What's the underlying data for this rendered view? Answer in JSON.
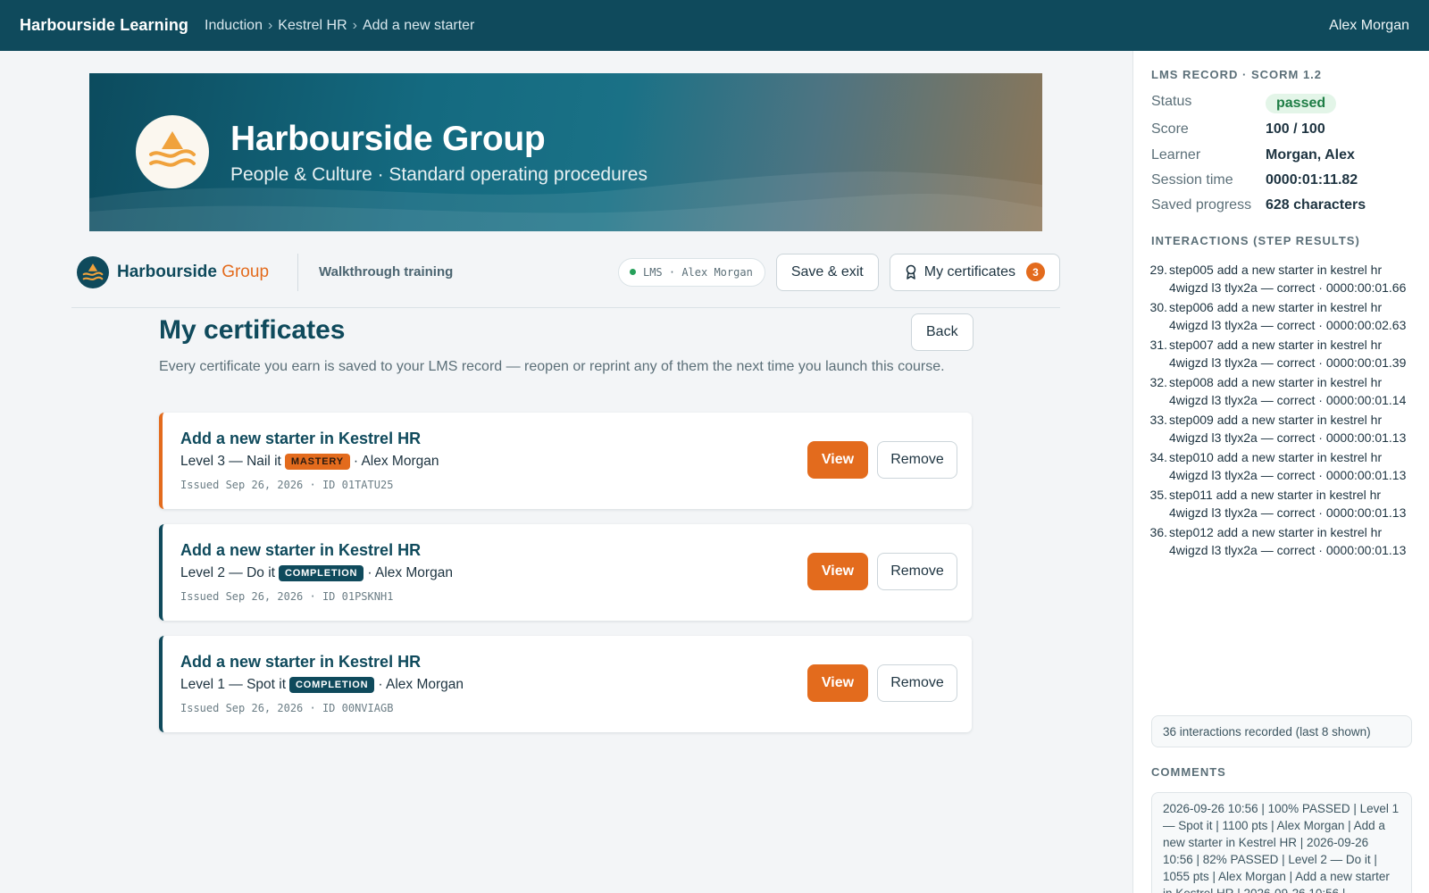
{
  "topbar": {
    "brand": "Harbourside Learning",
    "breadcrumbs": [
      "Induction",
      "Kestrel HR",
      "Add a new starter"
    ],
    "breadcrumb_separator": "›",
    "user": "Alex Morgan"
  },
  "hero": {
    "title": "Harbourside Group",
    "subtitle": "People & Culture · Standard operating procedures"
  },
  "subbar": {
    "org_name": "Harbourside",
    "org_accent": "Group",
    "training_label": "Walkthrough training",
    "lms_pill": "LMS · Alex Morgan",
    "save_exit_label": "Save & exit",
    "certificates_label": "My certificates",
    "certificates_count": "3"
  },
  "page": {
    "title": "My certificates",
    "back_label": "Back",
    "intro": "Every certificate you earn is saved to your LMS record — reopen or reprint any of them the next time you launch this course."
  },
  "certificates": [
    {
      "title": "Add a new starter in Kestrel HR",
      "level": "Level 3 — Nail it",
      "tag": "MASTERY",
      "learner": "· Alex Morgan",
      "meta": "Issued Sep 26, 2026 · ID 01TATU25",
      "view_label": "View",
      "remove_label": "Remove"
    },
    {
      "title": "Add a new starter in Kestrel HR",
      "level": "Level 2 — Do it",
      "tag": "COMPLETION",
      "learner": "· Alex Morgan",
      "meta": "Issued Sep 26, 2026 · ID 01PSKNH1",
      "view_label": "View",
      "remove_label": "Remove"
    },
    {
      "title": "Add a new starter in Kestrel HR",
      "level": "Level 1 — Spot it",
      "tag": "COMPLETION",
      "learner": "· Alex Morgan",
      "meta": "Issued Sep 26, 2026 · ID 00NVIAGB",
      "view_label": "View",
      "remove_label": "Remove"
    }
  ],
  "panel": {
    "record_heading": "LMS RECORD · SCORM 1.2",
    "record": [
      {
        "key": "Status",
        "value": "passed"
      },
      {
        "key": "Score",
        "value": "100 / 100"
      },
      {
        "key": "Learner",
        "value": "Morgan, Alex"
      },
      {
        "key": "Session time",
        "value": "0000:01:11.82"
      },
      {
        "key": "Saved progress",
        "value": "628 characters"
      }
    ],
    "interactions_heading": "INTERACTIONS (STEP RESULTS)",
    "interactions": [
      {
        "num": "29.",
        "text": "step005 add a new starter in kestrel hr 4wigzd l3 tlyx2a — correct · 0000:00:01.66"
      },
      {
        "num": "30.",
        "text": "step006 add a new starter in kestrel hr 4wigzd l3 tlyx2a — correct · 0000:00:02.63"
      },
      {
        "num": "31.",
        "text": "step007 add a new starter in kestrel hr 4wigzd l3 tlyx2a — correct · 0000:00:01.39"
      },
      {
        "num": "32.",
        "text": "step008 add a new starter in kestrel hr 4wigzd l3 tlyx2a — correct · 0000:00:01.14"
      },
      {
        "num": "33.",
        "text": "step009 add a new starter in kestrel hr 4wigzd l3 tlyx2a — correct · 0000:00:01.13"
      },
      {
        "num": "34.",
        "text": "step010 add a new starter in kestrel hr 4wigzd l3 tlyx2a — correct · 0000:00:01.13"
      },
      {
        "num": "35.",
        "text": "step011 add a new starter in kestrel hr 4wigzd l3 tlyx2a — correct · 0000:00:01.13"
      },
      {
        "num": "36.",
        "text": "step012 add a new starter in kestrel hr 4wigzd l3 tlyx2a — correct · 0000:00:01.13"
      }
    ],
    "interactions_note": "36 interactions recorded (last 8 shown)",
    "comments_heading": "COMMENTS",
    "comments": "2026-09-26 10:56 | 100% PASSED | Level 1 — Spot it | 1100 pts | Alex Morgan | Add a new starter in Kestrel HR | 2026-09-26 10:56 | 82% PASSED | Level 2 — Do it | 1055 pts | Alex Morgan | Add a new starter in Kestrel HR | 2026-09-26 10:56 |"
  },
  "colors": {
    "brand_teal": "#0f4a5c",
    "accent_orange": "#e36b1d",
    "status_green": "#1e7d45"
  }
}
